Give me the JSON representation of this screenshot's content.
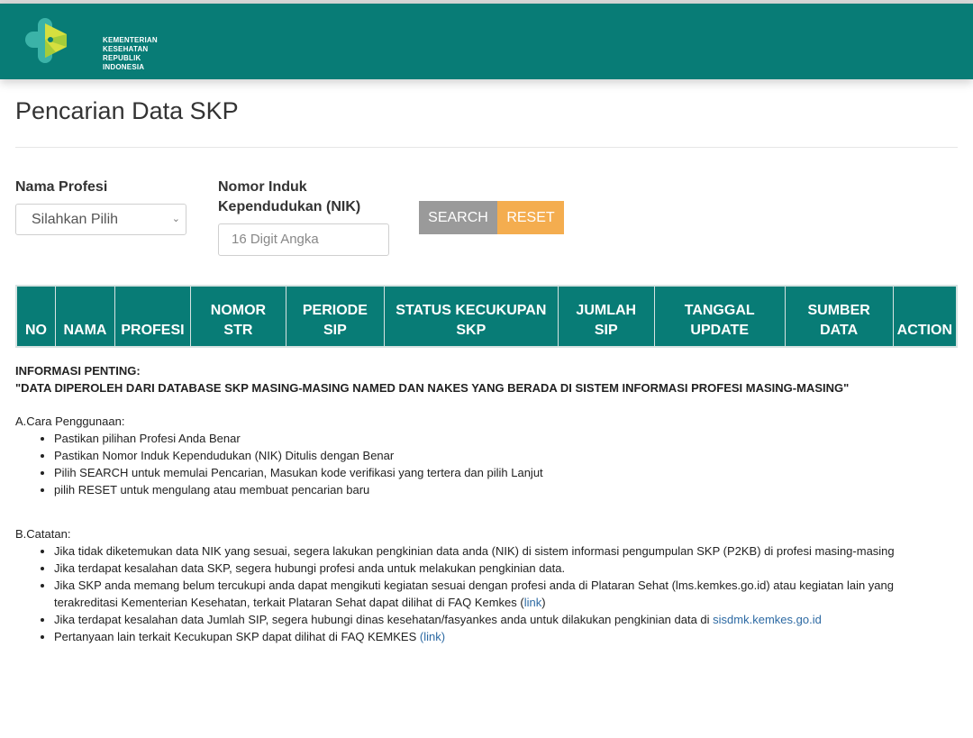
{
  "header": {
    "logo_lines": [
      "KEMENTERIAN",
      "KESEHATAN",
      "REPUBLIK",
      "INDONESIA"
    ],
    "brand_color": "#087c76",
    "logo_colors": {
      "teal": "#3bb3a8",
      "green": "#a5cc3a",
      "yellow": "#d6df3f"
    }
  },
  "page": {
    "title": "Pencarian Data SKP"
  },
  "form": {
    "profesi_label": "Nama Profesi",
    "profesi_value": "Silahkan Pilih",
    "nik_label_1": "Nomor Induk",
    "nik_label_2": "Kependudukan (NIK)",
    "nik_placeholder": "16 Digit Angka",
    "search_label": "SEARCH",
    "reset_label": "RESET"
  },
  "table": {
    "columns": [
      [
        "",
        "NO"
      ],
      [
        "",
        "NAMA"
      ],
      [
        "",
        "PROFESI"
      ],
      [
        "NOMOR",
        "STR"
      ],
      [
        "PERIODE",
        "SIP"
      ],
      [
        "STATUS KECUKUPAN",
        "SKP"
      ],
      [
        "JUMLAH",
        "SIP"
      ],
      [
        "TANGGAL",
        "UPDATE"
      ],
      [
        "SUMBER",
        "DATA"
      ],
      [
        "",
        "ACTION"
      ]
    ]
  },
  "info": {
    "heading": "INFORMASI PENTING:",
    "quote": "\"DATA DIPEROLEH DARI DATABASE SKP MASING-MASING NAMED DAN NAKES YANG BERADA DI SISTEM INFORMASI PROFESI MASING-MASING\"",
    "section_a_title": "A.Cara Penggunaan:",
    "section_a_items": [
      "Pastikan pilihan Profesi Anda Benar",
      "Pastikan Nomor Induk Kependudukan (NIK) Ditulis dengan Benar",
      "Pilih SEARCH untuk memulai Pencarian, Masukan kode verifikasi yang tertera dan pilih Lanjut",
      "pilih RESET untuk mengulang atau membuat pencarian baru"
    ],
    "section_b_title": "B.Catatan:",
    "b_item1": "Jika tidak diketemukan data NIK yang sesuai, segera lakukan pengkinian data anda (NIK) di sistem informasi pengumpulan SKP (P2KB) di profesi masing-masing",
    "b_item2": "Jika terdapat kesalahan data SKP, segera hubungi profesi anda untuk melakukan pengkinian data.",
    "b_item3_text": "Jika SKP anda memang belum tercukupi anda dapat mengikuti kegiatan sesuai dengan profesi anda di Plataran Sehat (lms.kemkes.go.id) atau kegiatan lain yang terakreditasi Kementerian Kesehatan, terkait Plataran Sehat dapat dilihat di FAQ Kemkes (",
    "b_item3_link": "link",
    "b_item3_end": ")",
    "b_item4_text": "Jika terdapat kesalahan data Jumlah SIP, segera hubungi dinas kesehatan/fasyankes anda untuk dilakukan pengkinian data di ",
    "b_item4_link": "sisdmk.kemkes.go.id",
    "b_item5_text": "Pertanyaan lain terkait Kecukupan SKP dapat dilihat di FAQ KEMKES ",
    "b_item5_link": "(link)"
  }
}
